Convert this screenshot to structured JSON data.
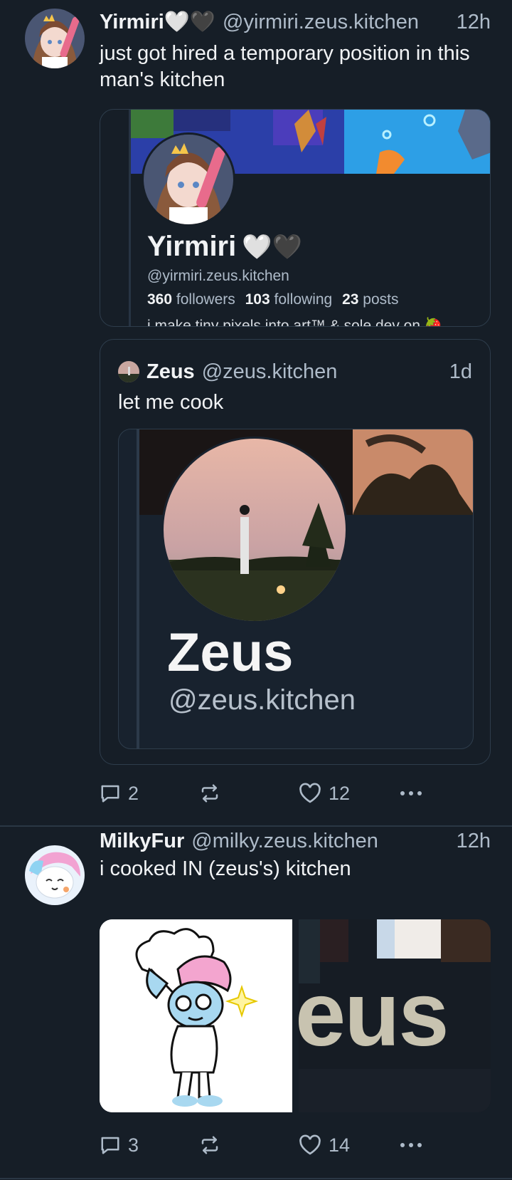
{
  "post1": {
    "author_name": "Yirmiri🤍🖤",
    "author_handle": "@yirmiri.zeus.kitchen",
    "time": "12h",
    "text": "just got hired a temporary position in this man's kitchen",
    "profile_card": {
      "name": "Yirmiri",
      "hearts": "🤍🖤",
      "handle": "@yirmiri.zeus.kitchen",
      "followers_count": "360",
      "followers_label": "followers",
      "following_count": "103",
      "following_label": "following",
      "posts_count": "23",
      "posts_label": "posts",
      "bio_partial": "i make tiny pixels into art™ & sole dev on 🍓"
    },
    "quote": {
      "author_name": "Zeus",
      "author_handle": "@zeus.kitchen",
      "time": "1d",
      "text": "let me cook",
      "card_name": "Zeus",
      "card_handle": "@zeus.kitchen"
    },
    "actions": {
      "replies": "2",
      "reposts": "",
      "likes": "12"
    }
  },
  "post2": {
    "author_name": "MilkyFur",
    "author_handle": "@milky.zeus.kitchen",
    "time": "12h",
    "text": "i cooked IN (zeus's) kitchen",
    "image2_text": "eus",
    "actions": {
      "replies": "3",
      "reposts": "",
      "likes": "14"
    }
  },
  "colors": {
    "background": "#161e27",
    "border": "#2e3d4c",
    "muted": "#aebbc9",
    "text": "#f1f3f5"
  }
}
